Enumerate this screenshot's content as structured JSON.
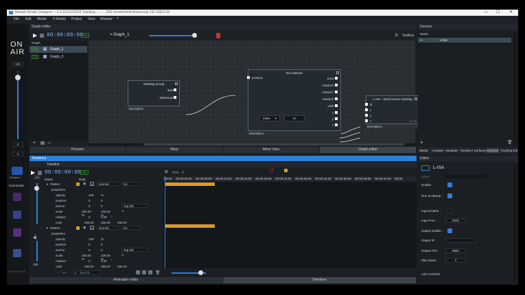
{
  "window": {
    "title": "Modulo Kinetic Designer -- 3.3.101/12/2019 Tracking -- ...... 0/92 showKinetic/show.mop 192.168.0.34",
    "controls": [
      "—",
      "☐",
      "✕"
    ]
  },
  "menu": [
    "File",
    "Edit",
    "Media",
    "V-Nodes",
    "Project",
    "View",
    "Window",
    "?"
  ],
  "left_rail": {
    "on_air_1": "ON",
    "on_air_2": "AIR",
    "value_top": "100",
    "value_0": "0",
    "value_2": "2",
    "connected": "Connected",
    "value_mid_2": "2",
    "value_100": "100",
    "icon_labels": [
      "Designer",
      "Show Control"
    ]
  },
  "graph_editor": {
    "header": "Graph editor",
    "on_label": "ON",
    "timecode": "00:00:00:00",
    "on_label_2": "ON",
    "breadcrumb": "> Graph_1",
    "toolbox_label": "Toolbox",
    "graph_list_header": "Graph",
    "graphs": [
      {
        "state": "ON",
        "name": "Graph_1"
      },
      {
        "state": "ON",
        "name": "Graph_2"
      }
    ],
    "nodes": {
      "tracking_group": {
        "title": "Tracking Group",
        "ports": [
          "data",
          "datalemap"
        ],
        "footer": "Description..."
      },
      "dot_selector": {
        "title": "Dot selector",
        "inputs": [
          "pointList"
        ],
        "outputs": [
          "point",
          "rotationX",
          "rotationY",
          "rotationZ",
          "valid",
          "x",
          "y",
          "z"
        ],
        "select_value": "index",
        "number_value": "10",
        "footer": "Description..."
      },
      "lisa": {
        "title": "L-ISA - Send source tracking",
        "ports": [
          "id",
          "x",
          "y",
          "z"
        ],
        "badge": "0.1 Hz",
        "footer": "Description..."
      }
    },
    "bottom_tabs": [
      "Preview",
      "Warp",
      "Mixer View",
      "Graph editor"
    ]
  },
  "timelines": {
    "header": "Timelines",
    "tab": "Timeline",
    "col_name": "Name",
    "col_data": "Data",
    "on_label": "ON",
    "timecode": "00:00:00:00",
    "view_label": "View",
    "view_value": "0",
    "ruler": [
      "00:00",
      "00:00:04:00",
      "00:00:08:00",
      "00:00:12:00",
      "00:00:16:00",
      "00:00:20:00",
      "00:00:24:00",
      "00:00:28:00",
      "00:00:32:00",
      "00:00:36:00",
      "00:00:40:00",
      "00:00:44:00",
      "00:00"
    ],
    "layers": [
      {
        "name": "Pattern",
        "blend": "Normal",
        "no": "No",
        "props_label": "properties",
        "props": [
          {
            "name": "opacity",
            "v1": "100",
            "v2": "%"
          },
          {
            "name": "position",
            "v1": "0",
            "v2": "0"
          },
          {
            "name": "anchor",
            "v1": "0",
            "v2": "0",
            "v3": "Top left"
          },
          {
            "name": "scale",
            "v1": "100.00 %",
            "v2": "100.00 %"
          },
          {
            "name": "rotation",
            "v1": "0",
            "v2": "0.00",
            "v3": "°"
          },
          {
            "name": "color",
            "v1": "255.00",
            "v2": "255.00",
            "v3": "255.00"
          }
        ]
      },
      {
        "name": "Pattern",
        "blend": "Normal",
        "no": "No",
        "props_label": "properties",
        "props": [
          {
            "name": "opacity",
            "v1": "100",
            "v2": "%"
          },
          {
            "name": "position",
            "v1": "0",
            "v2": "0"
          },
          {
            "name": "anchor",
            "v1": "0",
            "v2": "0",
            "v3": "Top left"
          },
          {
            "name": "scale",
            "v1": "100.00 %",
            "v2": "100.00 %"
          },
          {
            "name": "rotation",
            "v1": "0",
            "v2": "0.00",
            "v3": "°"
          },
          {
            "name": "color",
            "v1": "255.00",
            "v2": "255.00",
            "v3": "255.00"
          }
        ]
      }
    ],
    "search_placeholder": "Search...",
    "bottom_tabs": [
      "Animation editor",
      "Timelines"
    ]
  },
  "devices": {
    "header": "Devices",
    "col_name": "Name",
    "items": [
      "L-ISA"
    ],
    "tabs": [
      "Media",
      "V-Nodes",
      "Variables",
      "Timeline",
      "I-Surfaces",
      "Devices",
      "Tracking Edi"
    ]
  },
  "editor": {
    "header": "Editor",
    "device_name": "L-ISA",
    "cut_label": "Name",
    "fields": [
      {
        "label": "Enable :",
        "type": "check"
      },
      {
        "label": "Run at startup :",
        "type": "check"
      },
      {
        "label": "Input Enable :",
        "type": "check-off"
      },
      {
        "label": "Input Port :",
        "type": "value",
        "value": "9000"
      },
      {
        "label": "Output Enable :",
        "type": "check"
      },
      {
        "label": "Output IP :",
        "type": "value",
        "value": ""
      },
      {
        "label": "Output Port :",
        "type": "value",
        "value": "8880"
      },
      {
        "label": "Skip Mode :",
        "type": "value",
        "value": "0"
      }
    ],
    "last_received": "Last received"
  },
  "colors": {
    "accent_blue": "#2f7fd6",
    "on_green": "#2e7d32",
    "clip_orange": "#d99b2b",
    "record_red": "#c0392b"
  }
}
